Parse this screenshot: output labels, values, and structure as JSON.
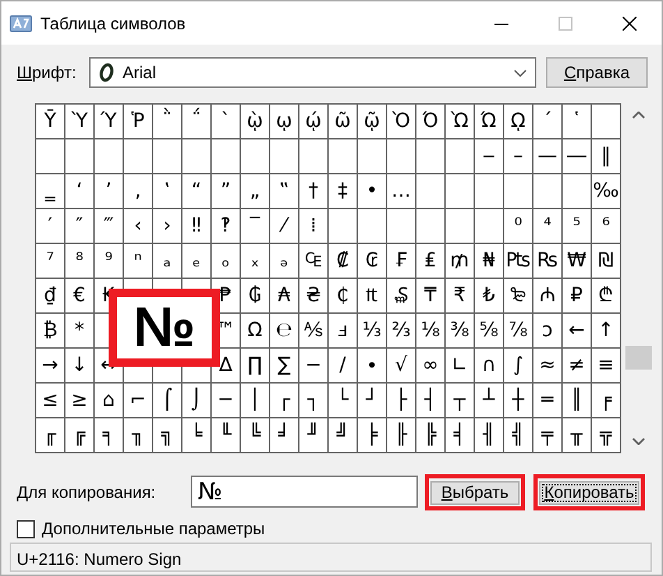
{
  "window": {
    "title": "Таблица символов"
  },
  "font": {
    "label": "Шрифт:",
    "value": "Arial"
  },
  "help_button": "Справка",
  "grid": {
    "rows": [
      [
        "Ῡ",
        "Ὺ",
        "Ύ",
        "Ῥ",
        "῭",
        "΅",
        "`",
        "ῲ",
        "ῳ",
        "ῴ",
        "ῶ",
        "ῷ",
        "Ὸ",
        "Ό",
        "Ὼ",
        "Ώ",
        "ῼ",
        "´",
        "῾",
        null
      ],
      [
        null,
        null,
        null,
        null,
        null,
        null,
        null,
        null,
        null,
        null,
        null,
        null,
        null,
        null,
        null,
        "‒",
        "–",
        "—",
        "―",
        "‖"
      ],
      [
        "‗",
        "‘",
        "’",
        "‚",
        "‛",
        "“",
        "”",
        "„",
        "‟",
        "†",
        "‡",
        "•",
        "…",
        null,
        null,
        null,
        null,
        null,
        null,
        "‰"
      ],
      [
        "′",
        "″",
        "‴",
        "‹",
        "›",
        "‼",
        "‽",
        "‾",
        "⁄",
        "⁞",
        null,
        null,
        null,
        null,
        null,
        null,
        "⁰",
        "⁴",
        "⁵",
        "⁶"
      ],
      [
        "⁷",
        "⁸",
        "⁹",
        "ⁿ",
        "ₐ",
        "ₑ",
        "ₒ",
        "ₓ",
        "ₔ",
        "₠",
        "₡",
        "₢",
        "₣",
        "₤",
        "₥",
        "₦",
        "₧",
        "₨",
        "₩",
        "₪"
      ],
      [
        "₫",
        "€",
        "₭",
        null,
        null,
        null,
        "₱",
        "₲",
        "₳",
        "₴",
        "₵",
        "₶",
        "₷",
        "₸",
        "₹",
        "₺",
        "₻",
        "₼",
        "₽",
        "₾"
      ],
      [
        "₿",
        "*",
        null,
        null,
        null,
        null,
        "™",
        "Ω",
        "℮",
        "⅍",
        "ⅎ",
        "⅓",
        "⅔",
        "⅛",
        "⅜",
        "⅝",
        "⅞",
        "ↄ",
        "←",
        "↑"
      ],
      [
        "→",
        "↓",
        "↔",
        null,
        null,
        null,
        "∆",
        "∏",
        "∑",
        "−",
        "∕",
        "∙",
        "√",
        "∞",
        "∟",
        "∩",
        "∫",
        "≈",
        "≠",
        "≡"
      ],
      [
        "≤",
        "≥",
        "⌂",
        "⌐",
        "⌠",
        "⌡",
        "─",
        "│",
        "┌",
        "┐",
        "└",
        "┘",
        "├",
        "┤",
        "┬",
        "┴",
        "┼",
        "═",
        "║",
        "╒"
      ],
      [
        "╓",
        "╔",
        "╕",
        "╖",
        "╗",
        "╘",
        "╙",
        "╚",
        "╛",
        "╜",
        "╝",
        "╞",
        "╟",
        "╠",
        "╡",
        "╢",
        "╣",
        "╤",
        "╥",
        "╦"
      ]
    ]
  },
  "preview": {
    "glyph": "№",
    "highlighted": true
  },
  "copy": {
    "label": "Для копирования:",
    "value": "№"
  },
  "buttons": [
    {
      "label": "Выбрать",
      "highlighted": true,
      "focused": false
    },
    {
      "label": "Копировать",
      "highlighted": true,
      "focused": true
    }
  ],
  "advanced": {
    "label": "Дополнительные параметры",
    "checked": false
  },
  "status_bar": "U+2116: Numero Sign"
}
